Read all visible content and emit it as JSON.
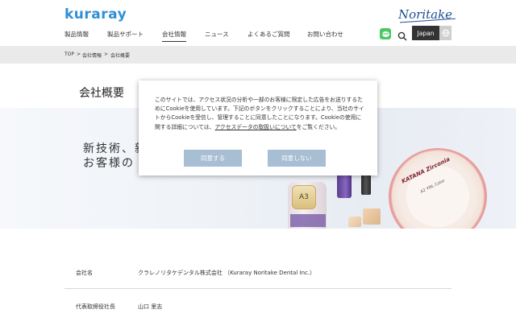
{
  "header": {
    "logo_left": "kuraray",
    "logo_right": "Noritake",
    "nav": [
      {
        "label": "製品情報"
      },
      {
        "label": "製品サポート"
      },
      {
        "label": "会社情報"
      },
      {
        "label": "ニュース"
      },
      {
        "label": "よくあるご質問"
      },
      {
        "label": "お問い合わせ"
      }
    ],
    "active_nav": "会社情報",
    "line_icon_text": "LINE",
    "language": "Japan"
  },
  "breadcrumb": {
    "items": [
      "TOP",
      "会社情報",
      "会社概要"
    ],
    "separator": ">"
  },
  "page_title": "会社概要",
  "hero": {
    "line1": "新技術、新",
    "line2": "お客様の Q",
    "jar_label": "A3",
    "disc_label": "KATANA Zirconia",
    "disc_sub": "A2  YML Color"
  },
  "cookie": {
    "text_before_link": "このサイトでは、アクセス状況の分析や一部のお客様に限定した広告をお送りするためにCookieを使用しています。下記のボタンをクリックすることにより、当社のサイトからCookieを受信し、管理することに同意したことになります。Cookieの使用に関する詳細については、",
    "link_text": "アクセスデータの取扱いについて",
    "text_after_link": "をご覧ください。",
    "agree_label": "同意する",
    "disagree_label": "同意しない"
  },
  "company_info": [
    {
      "key": "会社名",
      "value": "クラレノリタケデンタル株式会社 （Kuraray Noritake Dental Inc.）"
    },
    {
      "key": "代表取締役社長",
      "value": "山口 里志"
    }
  ],
  "colors": {
    "brand_blue": "#2f8fd6",
    "noritake_navy": "#1d4f91",
    "button_blue": "#a7bed3",
    "line_green": "#4cc764"
  }
}
